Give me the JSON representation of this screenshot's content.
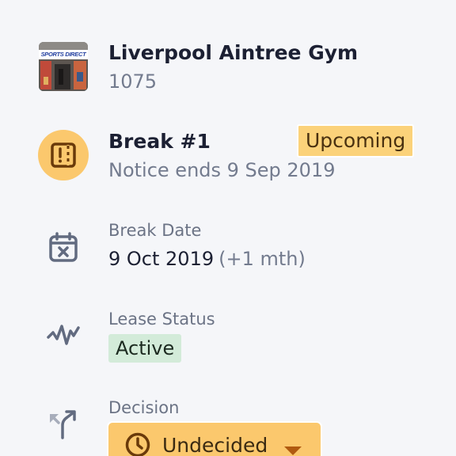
{
  "property": {
    "name": "Liverpool Aintree Gym",
    "code": "1075",
    "thumbnail_icon": "storefront-photo",
    "storefront_sign": "SPORTS DIRECT"
  },
  "break": {
    "title": "Break #1",
    "notice": "Notice ends 9 Sep 2019",
    "status_badge": "Upcoming",
    "icon": "break-notice-icon"
  },
  "break_date": {
    "label": "Break Date",
    "date": "9 Oct 2019",
    "relative": "(+1 mth)",
    "icon": "calendar-x-icon"
  },
  "lease_status": {
    "label": "Lease Status",
    "value": "Active",
    "icon": "activity-icon"
  },
  "decision": {
    "label": "Decision",
    "value": "Undecided",
    "icon": "direction-arrow-icon",
    "value_icon": "clock-icon"
  },
  "colors": {
    "background": "#f5f6f9",
    "accent_amber": "#fbc86d",
    "active_green": "#d3ebd9",
    "text_dark": "#1c2033",
    "text_muted": "#737b8e",
    "icon_gray": "#626b80",
    "dark_brown": "#6a3a0a"
  }
}
